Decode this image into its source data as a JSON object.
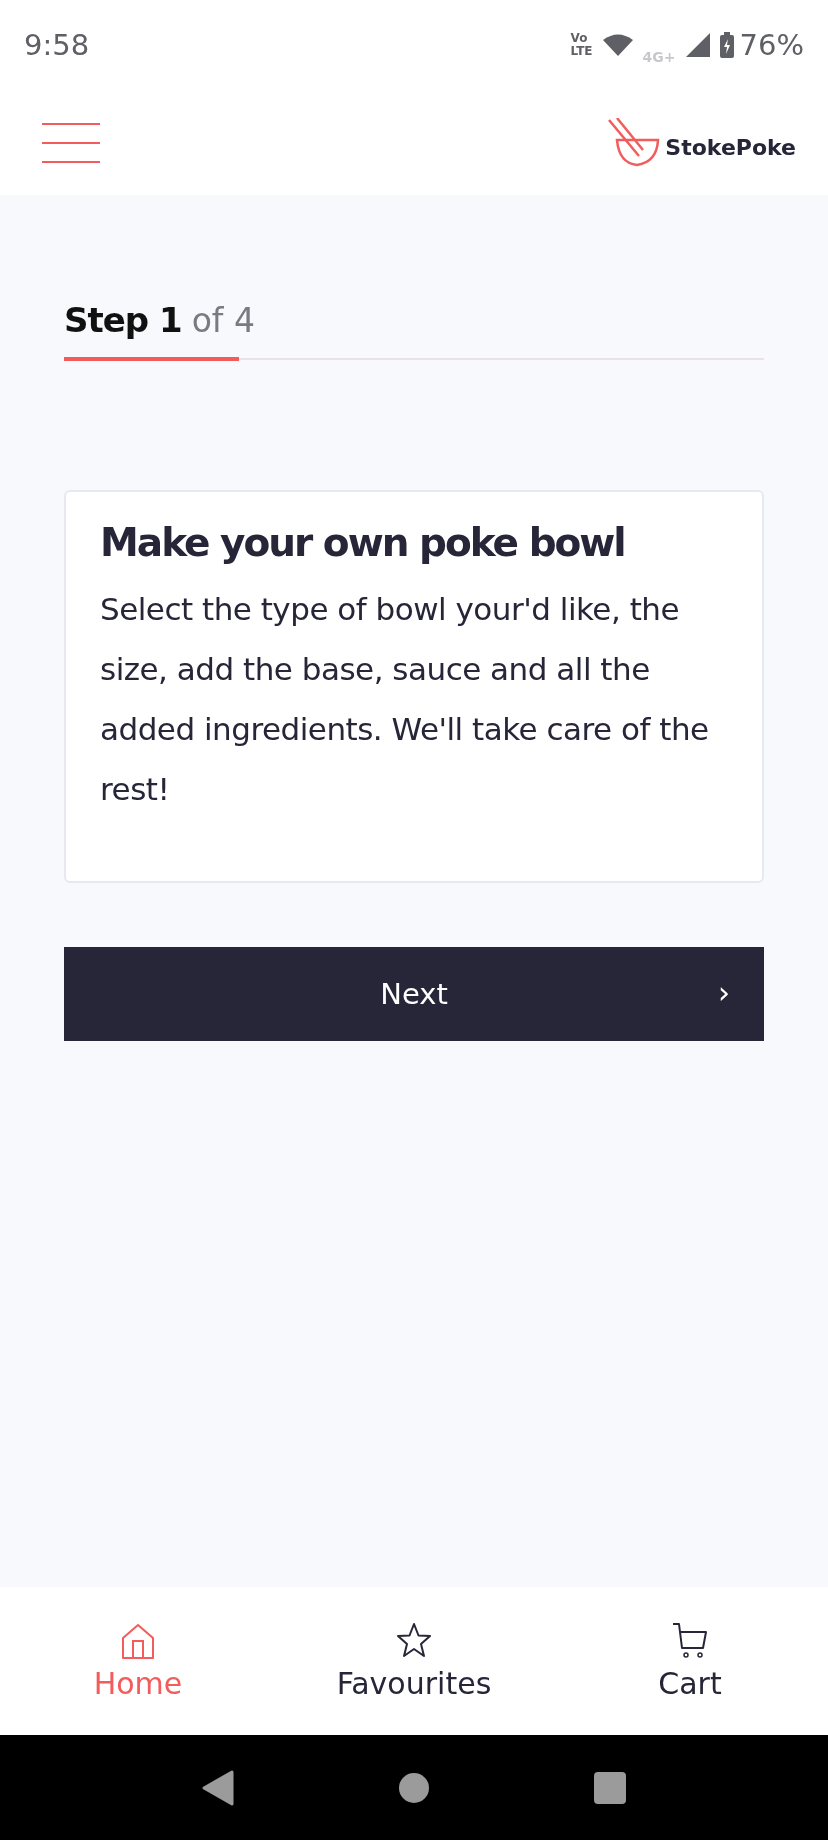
{
  "status_bar": {
    "time": "9:58",
    "volte_top": "Vo",
    "volte_bottom": "LTE",
    "network": "4G+",
    "battery": "76%"
  },
  "header": {
    "logo": "StokePoke"
  },
  "progress": {
    "step": "Step 1",
    "total": "of 4",
    "level": 0.25
  },
  "card": {
    "title": "Make your own poke bowl",
    "body": "Select the type of bowl your'd like, the size, add the base, sauce and all the added ingredients. We'll take care of the rest!"
  },
  "next_button": {
    "label": "Next",
    "arrow": "›"
  },
  "bottom_nav": [
    {
      "kind": "home",
      "label": "Home",
      "selected": true
    },
    {
      "kind": "star",
      "label": "Favourites",
      "selected": false
    },
    {
      "kind": "cart",
      "label": "Cart",
      "selected": false
    }
  ]
}
